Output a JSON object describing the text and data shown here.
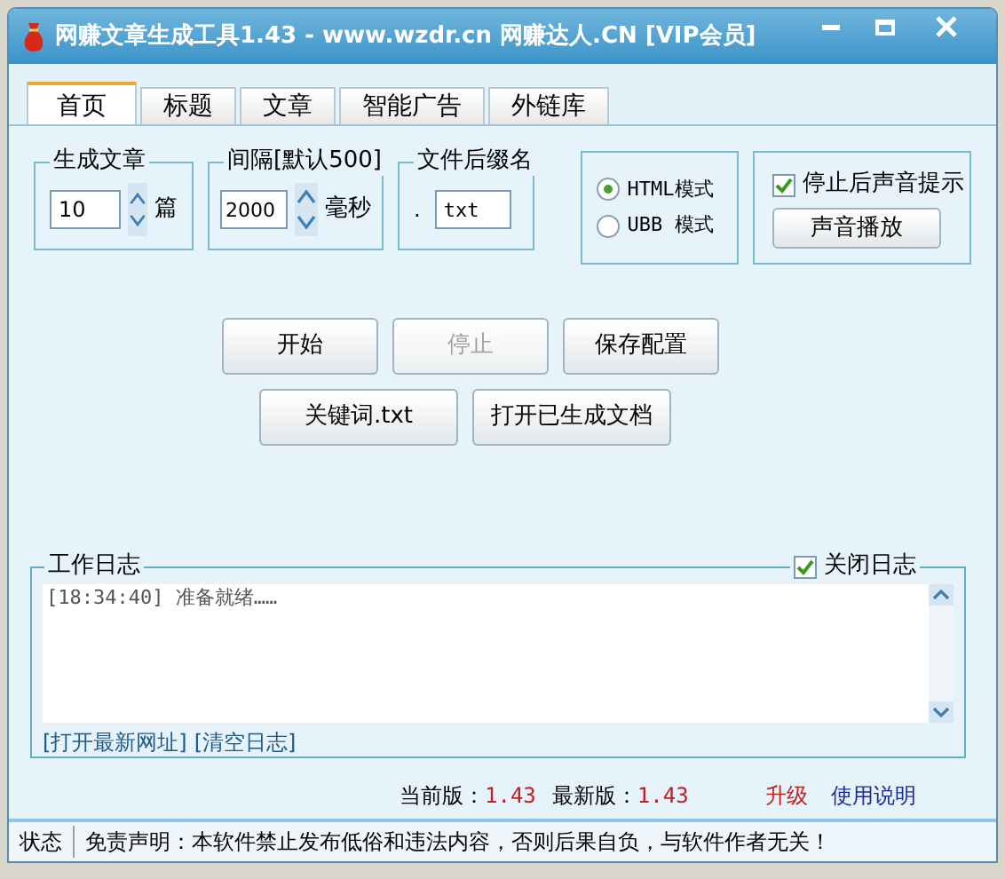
{
  "window": {
    "title": "网赚文章生成工具1.43 - www.wzdr.cn 网赚达人.CN [VIP会员]"
  },
  "tabs": [
    {
      "label": "首页",
      "selected": true
    },
    {
      "label": "标题",
      "selected": false
    },
    {
      "label": "文章",
      "selected": false
    },
    {
      "label": "智能广告",
      "selected": false
    },
    {
      "label": "外链库",
      "selected": false
    }
  ],
  "article_count": {
    "legend": "生成文章",
    "value": "10",
    "unit": "篇"
  },
  "interval": {
    "legend": "间隔[默认500]",
    "value": "2000",
    "unit": "毫秒"
  },
  "suffix": {
    "legend": "文件后缀名",
    "prefix": ".",
    "value": "txt"
  },
  "modes": [
    {
      "label": "HTML模式",
      "selected": true
    },
    {
      "label": "UBB 模式",
      "selected": false
    }
  ],
  "sound": {
    "checkbox": {
      "label": "停止后声音提示",
      "checked": true
    },
    "button": "声音播放"
  },
  "button_rows": [
    [
      {
        "label": "开始",
        "disabled": false
      },
      {
        "label": "停止",
        "disabled": true
      },
      {
        "label": "保存配置",
        "disabled": false
      }
    ],
    [
      {
        "label": "关键词.txt",
        "disabled": false
      },
      {
        "label": "打开已生成文档",
        "disabled": false
      }
    ]
  ],
  "log": {
    "legend": "工作日志",
    "close_log": {
      "label": "关闭日志",
      "checked": true
    },
    "lines": [
      "[18:34:40] 准备就绪……"
    ],
    "links": [
      "[打开最新网址]",
      "[清空日志]"
    ]
  },
  "version": {
    "current_label": "当前版：",
    "current": "1.43",
    "latest_label": "最新版：",
    "latest": "1.43",
    "upgrade": "升级",
    "help": "使用说明"
  },
  "status_bar": {
    "label": "状态",
    "message": "免责声明：本软件禁止发布低俗和违法内容，否则后果自负，与软件作者无关！"
  }
}
